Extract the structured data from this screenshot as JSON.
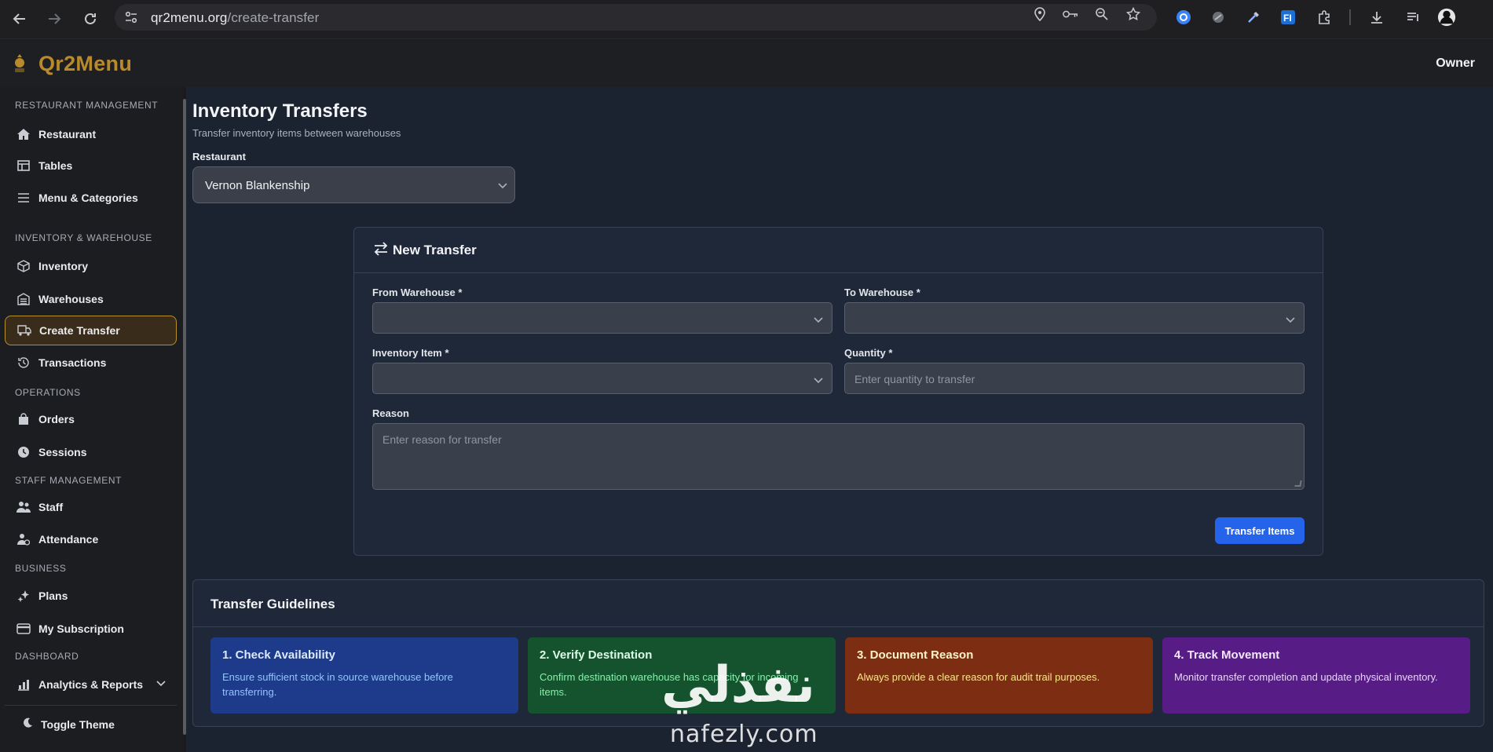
{
  "browser": {
    "url_host": "qr2menu.org",
    "url_path": "/create-transfer"
  },
  "header": {
    "app_name": "Qr2Menu",
    "user_role": "Owner"
  },
  "sidebar": {
    "sections": [
      {
        "title": "RESTAURANT MANAGEMENT",
        "items": [
          "Restaurant",
          "Tables",
          "Menu & Categories"
        ]
      },
      {
        "title": "INVENTORY & WAREHOUSE",
        "items": [
          "Inventory",
          "Warehouses",
          "Create Transfer",
          "Transactions"
        ]
      },
      {
        "title": "OPERATIONS",
        "items": [
          "Orders",
          "Sessions"
        ]
      },
      {
        "title": "STAFF MANAGEMENT",
        "items": [
          "Staff",
          "Attendance"
        ]
      },
      {
        "title": "BUSINESS",
        "items": [
          "Plans",
          "My Subscription"
        ]
      },
      {
        "title": "DASHBOARD",
        "items": [
          "Analytics & Reports"
        ]
      }
    ],
    "active_item": "Create Transfer",
    "toggle_theme": "Toggle Theme"
  },
  "page": {
    "title": "Inventory Transfers",
    "subtitle": "Transfer inventory items between warehouses",
    "restaurant_label": "Restaurant",
    "restaurant_value": "Vernon Blankenship"
  },
  "transfer_form": {
    "title": "New Transfer",
    "from_label": "From Warehouse *",
    "to_label": "To Warehouse *",
    "item_label": "Inventory Item *",
    "quantity_label": "Quantity *",
    "quantity_placeholder": "Enter quantity to transfer",
    "reason_label": "Reason",
    "reason_placeholder": "Enter reason for transfer",
    "submit": "Transfer Items"
  },
  "guidelines": {
    "title": "Transfer Guidelines",
    "items": [
      {
        "title": "1. Check Availability",
        "text": "Ensure sufficient stock in source warehouse before transferring.",
        "color": "#1e3a8a"
      },
      {
        "title": "2. Verify Destination",
        "text": "Confirm destination warehouse has capacity for incoming items.",
        "color": "#14532d"
      },
      {
        "title": "3. Document Reason",
        "text": "Always provide a clear reason for audit trail purposes.",
        "color": "#7c2d12"
      },
      {
        "title": "4. Track Movement",
        "text": "Monitor transfer completion and update physical inventory.",
        "color": "#581c87"
      }
    ]
  },
  "watermark": {
    "arabic": "نفذلي",
    "latin": "nafezly.com"
  },
  "colors": {
    "brand": "#b88a2c",
    "primary_button": "#2563eb"
  }
}
